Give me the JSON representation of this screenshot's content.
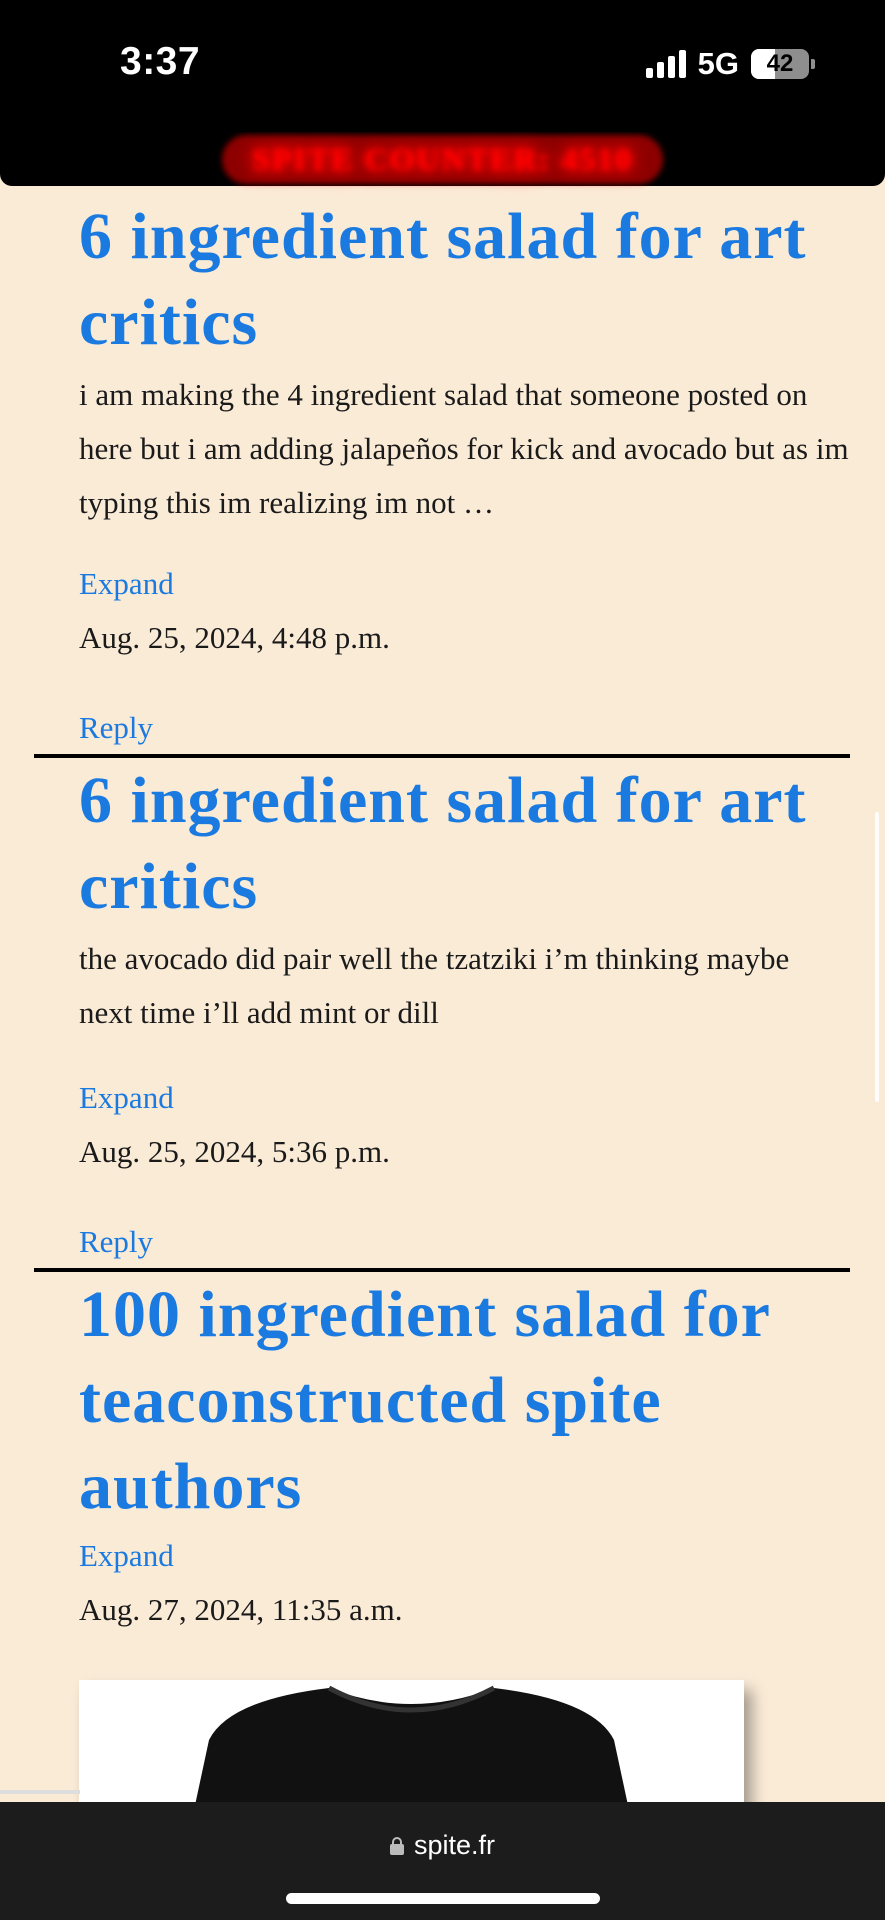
{
  "status": {
    "time": "3:37",
    "network": "5G",
    "battery": "42",
    "battery_level": 0.42
  },
  "counter": {
    "text": "SPITE COUNTER: 4510"
  },
  "posts": [
    {
      "title": "6 ingredient salad for art critics",
      "body": "i am making the 4 ingredient salad that someone posted on here but i am adding jalapeños for kick and avocado but as im typing this im realizing im not …",
      "expand": "Expand",
      "date": "Aug. 25, 2024, 4:48 p.m.",
      "reply": "Reply"
    },
    {
      "title": "6 ingredient salad for art critics",
      "body": "the avocado did pair well the tzatziki i’m thinking maybe next time i’ll add mint or dill",
      "expand": "Expand",
      "date": "Aug. 25, 2024, 5:36 p.m.",
      "reply": "Reply"
    },
    {
      "title": "100 ingredient salad for teaconstructed spite authors",
      "expand": "Expand",
      "date": "Aug. 27, 2024, 11:35 a.m."
    }
  ],
  "browser": {
    "url": "spite.fr"
  },
  "colors": {
    "background": "#faebd7",
    "link": "#1a7ae0",
    "counter": "#ff0000"
  }
}
